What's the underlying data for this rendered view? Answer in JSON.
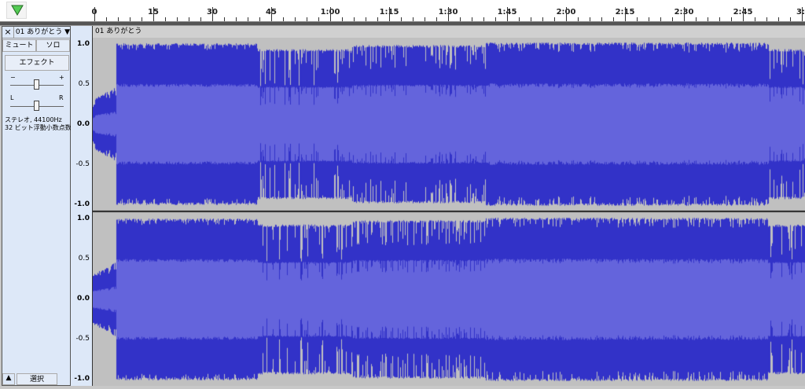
{
  "ruler": {
    "ticks": [
      "0",
      "15",
      "30",
      "45",
      "1:00",
      "1:15",
      "1:30",
      "1:45",
      "2:00",
      "2:15",
      "2:30",
      "2:45",
      "3:"
    ]
  },
  "track": {
    "name": "01 ありがとう",
    "close_label": "×",
    "mute_label": "ミュート",
    "solo_label": "ソロ",
    "effect_label": "エフェクト",
    "gain_minus": "−",
    "gain_plus": "+",
    "pan_left": "L",
    "pan_right": "R",
    "info_line1": "ステレオ, 44100Hz",
    "info_line2": "32 ビット浮動小数点数",
    "collapse_label": "▲",
    "select_label": "選択",
    "scale": [
      "1.0",
      "0.5",
      "0.0",
      "-0.5",
      "-1.0"
    ]
  },
  "colors": {
    "peak": "#3232c8",
    "rms": "#6464dc",
    "background": "#c0c0c0"
  }
}
